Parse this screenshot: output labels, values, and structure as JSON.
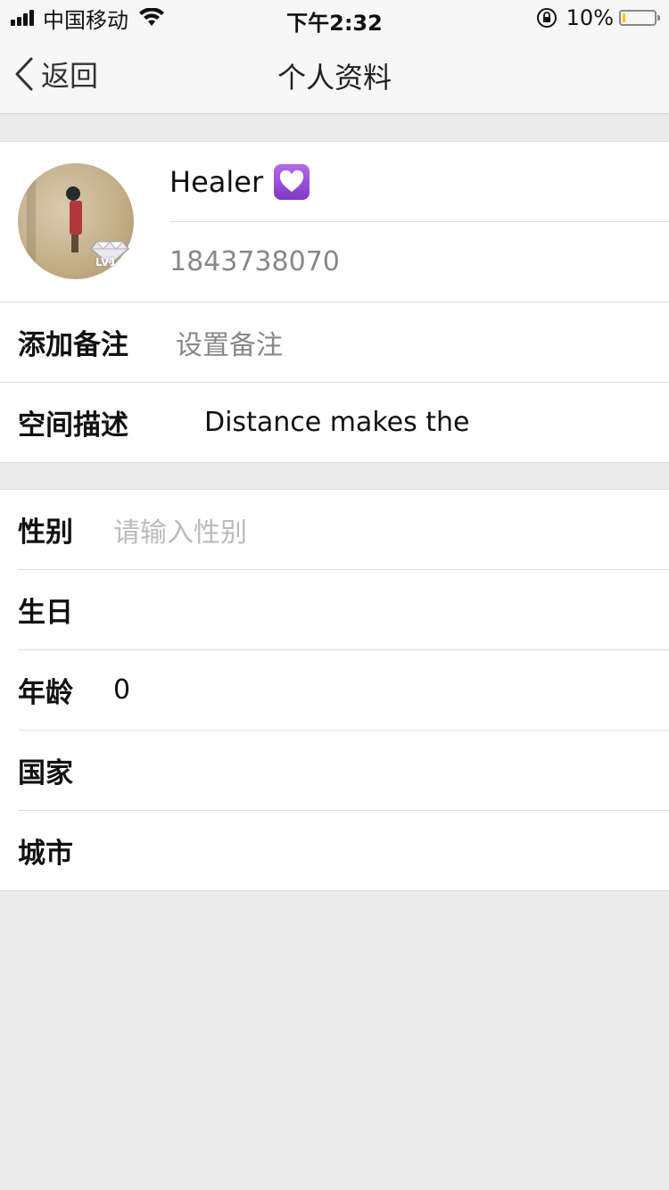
{
  "status_bar": {
    "carrier": "中国移动",
    "time": "下午2:32",
    "battery_percent": "10%",
    "battery_level": 0.1
  },
  "nav": {
    "back_label": "返回",
    "title": "个人资料"
  },
  "profile": {
    "name": "Healer",
    "id": "1843738070",
    "level_badge": "LV1",
    "badge_icon": "purple-heart-icon"
  },
  "fields1": {
    "remark_label": "添加备注",
    "remark_placeholder": "设置备注",
    "desc_label": "空间描述",
    "desc_value": "Distance makes the"
  },
  "fields2": {
    "gender_label": "性别",
    "gender_placeholder": "请输入性别",
    "birthday_label": "生日",
    "age_label": "年龄",
    "age_value": "0",
    "country_label": "国家",
    "city_label": "城市"
  },
  "colors": {
    "background": "#ebebeb",
    "bar": "#f7f7f7",
    "placeholder": "#bbbbbb",
    "secondary_text": "#888888",
    "badge_purple": "#9b4fd8",
    "battery_fill": "#f5c400"
  }
}
